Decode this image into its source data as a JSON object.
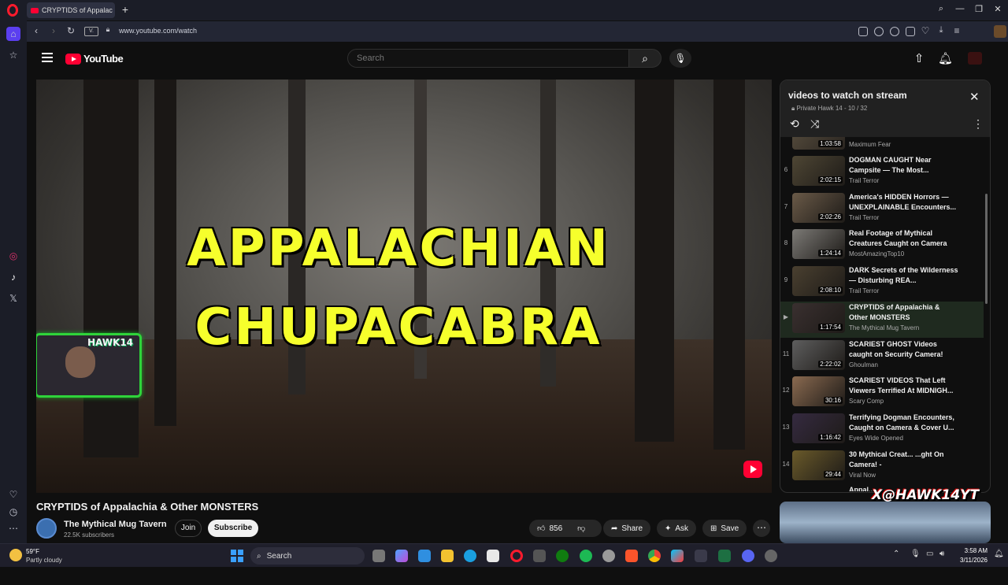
{
  "browser": {
    "tab_title": "CRYPTIDS of Appalac",
    "url": "www.youtube.com/watch",
    "vpn_label": "V."
  },
  "youtube": {
    "logo_text": "YouTube",
    "search_placeholder": "Search"
  },
  "video": {
    "overlay_line1": "APPALACHIAN",
    "overlay_line2": "CHUPACABRA",
    "webcam_label": "HAWK14",
    "title": "CRYPTIDS of Appalachia & Other MONSTERS",
    "channel_name": "The Mythical Mug Tavern",
    "subscribers": "22.5K subscribers",
    "join_label": "Join",
    "subscribe_label": "Subscribe",
    "likes": "856",
    "share_label": "Share",
    "ask_label": "Ask",
    "save_label": "Save"
  },
  "playlist": {
    "title": "videos to watch on stream",
    "subtitle": "Private Hawk 14 - 10 / 32",
    "partial_top": {
      "duration": "1:03:58",
      "channel": "Maximum Fear"
    },
    "items": [
      {
        "index": "6",
        "title": "DOGMAN CAUGHT Near Campsite — The Most...",
        "channel": "Trail Terror",
        "duration": "2:02:15",
        "current": false
      },
      {
        "index": "7",
        "title": "America's HIDDEN Horrors — UNEXPLAINABLE Encounters...",
        "channel": "Trail Terror",
        "duration": "2:02:26",
        "current": false
      },
      {
        "index": "8",
        "title": "Real Footage of Mythical Creatures Caught on Camera",
        "channel": "MostAmazingTop10",
        "duration": "1:24:14",
        "current": false
      },
      {
        "index": "9",
        "title": "DARK Secrets of the Wilderness — Disturbing REA...",
        "channel": "Trail Terror",
        "duration": "2:08:10",
        "current": false
      },
      {
        "index": "▶",
        "title": "CRYPTIDS of Appalachia & Other MONSTERS",
        "channel": "The Mythical Mug Tavern",
        "duration": "1:17:54",
        "current": true
      },
      {
        "index": "11",
        "title": "SCARIEST GHOST Videos caught on Security Camera!",
        "channel": "Ghoulman",
        "duration": "2:22:02",
        "current": false
      },
      {
        "index": "12",
        "title": "SCARIEST VIDEOS That Left Viewers Terrified At MIDNIGH...",
        "channel": "Scary Comp",
        "duration": "30:16",
        "current": false
      },
      {
        "index": "13",
        "title": "Terrifying Dogman Encounters, Caught on Camera & Cover U...",
        "channel": "Eyes Wide Opened",
        "duration": "1:16:42",
        "current": false
      },
      {
        "index": "14",
        "title": "30 Mythical Creat... ...ght On Camera! -",
        "channel": "Viral Now",
        "duration": "29:44",
        "current": false
      }
    ],
    "partial_bottom_title": "Appal..."
  },
  "overlay_logo": "X@HAWK14YT",
  "taskbar": {
    "temperature": "59°F",
    "weather": "Partly cloudy",
    "search_label": "Search",
    "time": "3:58 AM",
    "date": "3/11/2026"
  },
  "colors": {
    "youtube_red": "#ff0033",
    "title_yellow": "#f6ff2c",
    "webcam_green": "#2fd43a",
    "opera_red": "#ff1b2d"
  }
}
